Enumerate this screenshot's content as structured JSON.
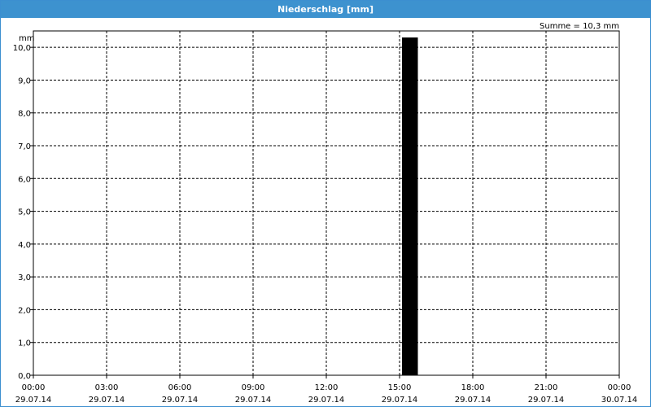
{
  "chart_data": {
    "type": "bar",
    "title": "Niederschlag [mm]",
    "ylabel": "mm",
    "summary": "Summe = 10,3 mm",
    "ylim": [
      0,
      10.5
    ],
    "y_ticks": [
      "0,0",
      "1,0",
      "2,0",
      "3,0",
      "4,0",
      "5,0",
      "6,0",
      "7,0",
      "8,0",
      "9,0",
      "10,0"
    ],
    "x_range_hours": [
      0,
      24
    ],
    "x_ticks": [
      {
        "time": "00:00",
        "date": "29.07.14"
      },
      {
        "time": "03:00",
        "date": "29.07.14"
      },
      {
        "time": "06:00",
        "date": "29.07.14"
      },
      {
        "time": "09:00",
        "date": "29.07.14"
      },
      {
        "time": "12:00",
        "date": "29.07.14"
      },
      {
        "time": "15:00",
        "date": "29.07.14"
      },
      {
        "time": "18:00",
        "date": "29.07.14"
      },
      {
        "time": "21:00",
        "date": "29.07.14"
      },
      {
        "time": "00:00",
        "date": "30.07.14"
      }
    ],
    "bars": [
      {
        "start": "29.07.14 15:00",
        "end": "29.07.14 15:45",
        "value": 10.3
      }
    ],
    "grid": true,
    "bar_color": "#000000"
  }
}
